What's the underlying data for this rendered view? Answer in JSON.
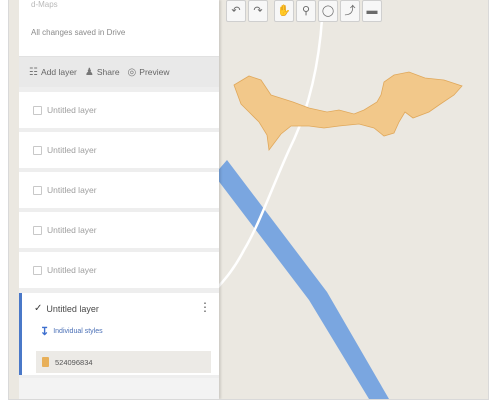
{
  "panel": {
    "map_title": "d-Maps",
    "save_status": "All changes saved in Drive"
  },
  "actions": {
    "add_layer": "Add layer",
    "share": "Share",
    "preview": "Preview"
  },
  "layers": [
    {
      "label": "Untitled layer",
      "checked": false
    },
    {
      "label": "Untitled layer",
      "checked": false
    },
    {
      "label": "Untitled layer",
      "checked": false
    },
    {
      "label": "Untitled layer",
      "checked": false
    },
    {
      "label": "Untitled layer",
      "checked": false
    }
  ],
  "active_layer": {
    "label": "Untitled layer",
    "checked": true,
    "style_label": "Individual styles",
    "feature_label": "524096834"
  },
  "toolbar": {
    "tools": [
      "undo-icon",
      "redo-icon",
      "hand-icon",
      "marker-icon",
      "draw-line-icon",
      "directions-icon",
      "ruler-icon"
    ]
  },
  "colors": {
    "polygon_fill": "#f2c88a",
    "polygon_stroke": "#e0a85b",
    "river": "#7aa6e0",
    "road": "#ffffff",
    "map_bg": "#ebe8e1",
    "active_accent": "#4a78c8"
  }
}
